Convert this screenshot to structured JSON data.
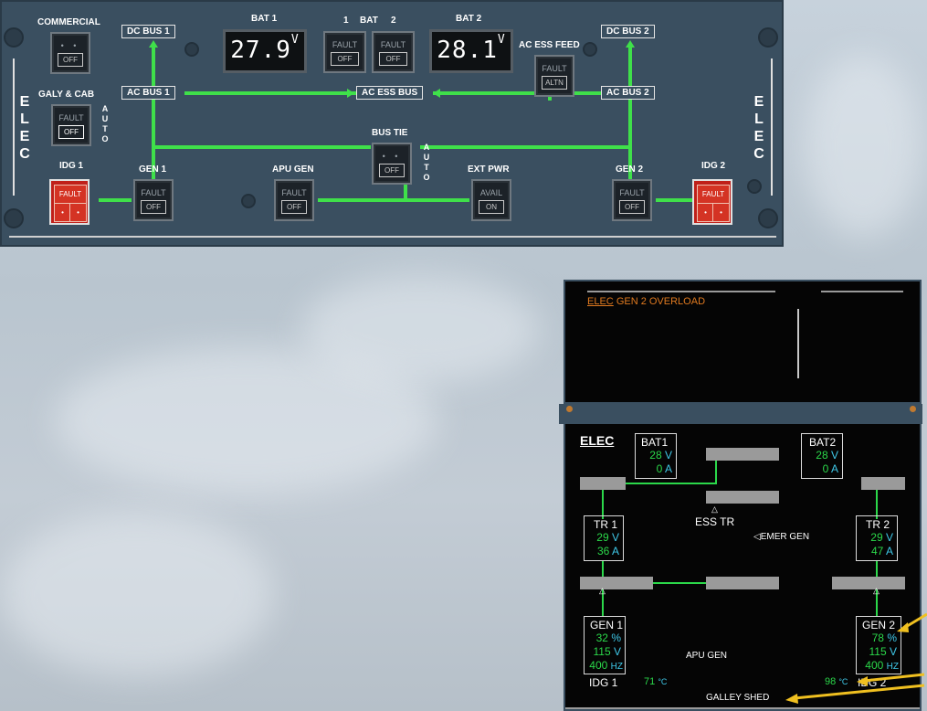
{
  "panel": {
    "elec_label": [
      "E",
      "L",
      "E",
      "C"
    ],
    "auto_label": [
      "A",
      "U",
      "T",
      "O"
    ],
    "commercial": {
      "label": "COMMERCIAL",
      "state": "OFF"
    },
    "galy_cab": {
      "label": "GALY & CAB",
      "fault": "FAULT",
      "state": "OFF"
    },
    "idg1": {
      "label": "IDG 1",
      "fault": "FAULT"
    },
    "idg2": {
      "label": "IDG 2",
      "fault": "FAULT"
    },
    "gen1": {
      "label": "GEN 1",
      "fault": "FAULT",
      "state": "OFF"
    },
    "gen2": {
      "label": "GEN 2",
      "fault": "FAULT",
      "state": "OFF"
    },
    "apu_gen": {
      "label": "APU GEN",
      "fault": "FAULT",
      "state": "OFF"
    },
    "ext_pwr": {
      "label": "EXT PWR",
      "avail": "AVAIL",
      "state": "ON"
    },
    "bus_tie": {
      "label": "BUS TIE",
      "state": "OFF"
    },
    "bat1": {
      "label": "BAT 1",
      "value": "27.9",
      "unit": "V"
    },
    "bat2": {
      "label": "BAT 2",
      "value": "28.1",
      "unit": "V"
    },
    "bat_pb": {
      "label_1": "1",
      "label_mid": "BAT",
      "label_2": "2",
      "fault": "FAULT",
      "state": "OFF"
    },
    "ac_ess_feed": {
      "label": "AC ESS FEED",
      "fault": "FAULT",
      "state": "ALTN"
    },
    "buses": {
      "dc1": "DC BUS 1",
      "dc2": "DC BUS 2",
      "ac1": "AC BUS 1",
      "ac2": "AC BUS 2",
      "ac_ess": "AC ESS BUS"
    }
  },
  "ecam_upper": {
    "title": "ELEC",
    "message": "GEN 2 OVERLOAD"
  },
  "ecam_lower": {
    "title": "ELEC",
    "bat1": {
      "label": "BAT1",
      "volts": "28",
      "amps": "0"
    },
    "bat2": {
      "label": "BAT2",
      "volts": "28",
      "amps": "0"
    },
    "tr1": {
      "label": "TR 1",
      "volts": "29",
      "amps": "36"
    },
    "tr2": {
      "label": "TR 2",
      "volts": "29",
      "amps": "47"
    },
    "ess_tr": "ESS TR",
    "emer_gen": "EMER GEN",
    "gen1": {
      "label": "GEN 1",
      "pct": "32",
      "volts": "115",
      "hz": "400"
    },
    "gen2": {
      "label": "GEN 2",
      "pct": "78",
      "volts": "115",
      "hz": "400"
    },
    "apu_gen": "APU GEN",
    "idg1": {
      "label": "IDG 1",
      "temp": "71"
    },
    "idg2": {
      "label": "IDG 2",
      "temp": "98"
    },
    "galley_shed": "GALLEY SHED",
    "units": {
      "v": "V",
      "a": "A",
      "pct": "%",
      "hz": "HZ",
      "degc": "°C"
    }
  },
  "colors": {
    "panel": "#3a4f60",
    "green_line": "#3fe04a",
    "amber": "#e07a20",
    "ecam_green": "#2bd84a",
    "ecam_cyan": "#3fc8e8",
    "arrow": "#f0c020"
  }
}
